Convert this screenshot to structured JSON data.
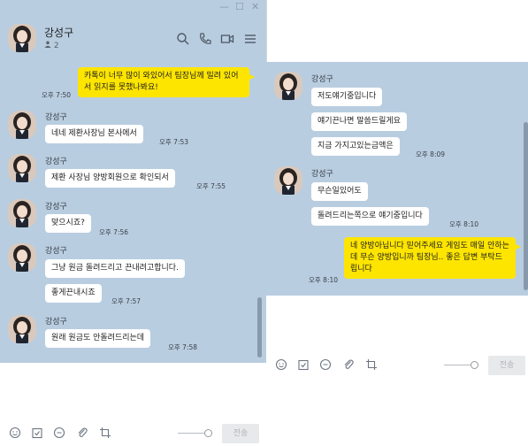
{
  "window_controls": {
    "minimize": "—",
    "maximize": "☐",
    "close": "✕"
  },
  "header": {
    "title": "강성구",
    "members": "2"
  },
  "toolbar_icons": [
    "emoticon-icon",
    "calendar-icon",
    "chat-bubble-icon",
    "attach-icon",
    "crop-icon"
  ],
  "send_label": "전송",
  "colors": {
    "chat_bg": "#b9cde0",
    "my_bubble": "#fee500",
    "other_bubble": "#ffffff"
  },
  "left_messages": [
    {
      "text": "카톡이 너무 많이 와있어서 팀장님께 밀려 있어서 읽지를 못했나봐요!",
      "time": "오후 7:50"
    },
    {
      "name": "강성구",
      "text": "네네 제환사장님 본사에서",
      "time": "오후 7:53"
    },
    {
      "name": "강성구",
      "text": "제환 사장님 양방회원으로 확인되서",
      "time": "오후 7:55"
    },
    {
      "name": "강성구",
      "text": "맞으시죠?",
      "time": "오후 7:56"
    },
    {
      "name": "강성구",
      "texts": [
        "그냥 원금 돌려드리고 끈내려고합니다.",
        "좋게끈내시죠"
      ],
      "time": "오후 7:57"
    },
    {
      "name": "강성구",
      "text": "원래 원금도 안돌려드리는데",
      "time": "오후 7:58"
    }
  ],
  "right_messages": [
    {
      "name": "강성구",
      "texts": [
        "저도얘기중입니다",
        "얘기끈나면 말씀드릴게요",
        "지금 가지고있는금액은"
      ],
      "time": "오후 8:09"
    },
    {
      "name": "강성구",
      "texts": [
        "무슨일있어도",
        "돌려드리는쪽으로 얘기중입니다"
      ],
      "time": "오후 8:10"
    },
    {
      "text": "네 양방아닙니다 믿어주세요 게임도 매일 안하는데 무슨 양방입니까 팀장님.. 좋은 답변 부탁드립니다",
      "time": "오후 8:10"
    }
  ]
}
